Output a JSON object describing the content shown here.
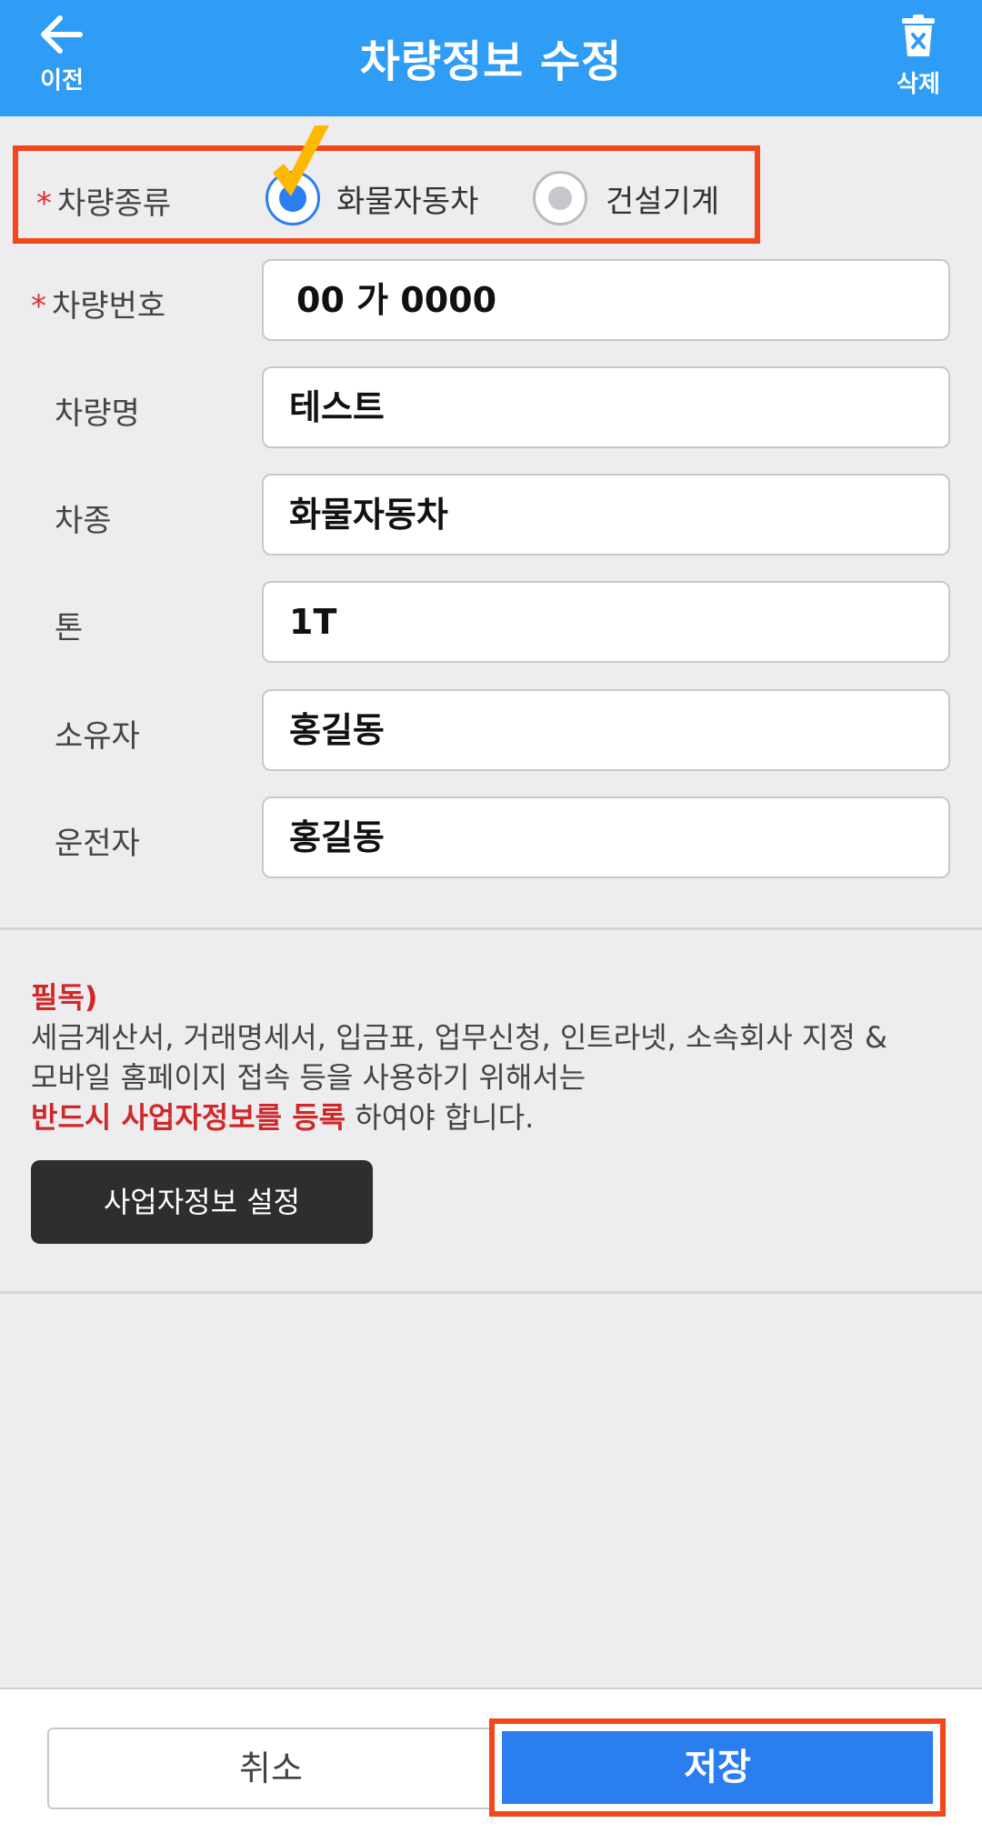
{
  "header": {
    "back_label": "이전",
    "title": "차량정보 수정",
    "delete_label": "삭제"
  },
  "form": {
    "vehicle_type": {
      "label": "차량종류",
      "options": [
        {
          "label": "화물자동차",
          "selected": true
        },
        {
          "label": "건설기계",
          "selected": false
        }
      ]
    },
    "plate": {
      "label": "차량번호",
      "value": "00 가 0000"
    },
    "name": {
      "label": "차량명",
      "value": "테스트"
    },
    "kind": {
      "label": "차종",
      "value": "화물자동차"
    },
    "ton": {
      "label": "톤",
      "value": "1T"
    },
    "owner": {
      "label": "소유자",
      "value": "홍길동"
    },
    "driver": {
      "label": "운전자",
      "value": "홍길동"
    }
  },
  "notice": {
    "heading": "필독)",
    "line1": "세금계산서, 거래명세서, 입금표, 업무신청, 인트라넷, 소속회사 지정 &",
    "line2": "모바일 홈페이지 접속 등을 사용하기 위해서는",
    "emphasis": "반드시 사업자정보를 등록",
    "suffix": " 하여야 합니다."
  },
  "business_button": "사업자정보 설정",
  "footer": {
    "cancel_label": "취소",
    "save_label": "저장"
  },
  "colors": {
    "header": "#2f9cf5",
    "accent": "#2a7ef0",
    "highlight": "#f2471a",
    "warning": "#d02828"
  }
}
